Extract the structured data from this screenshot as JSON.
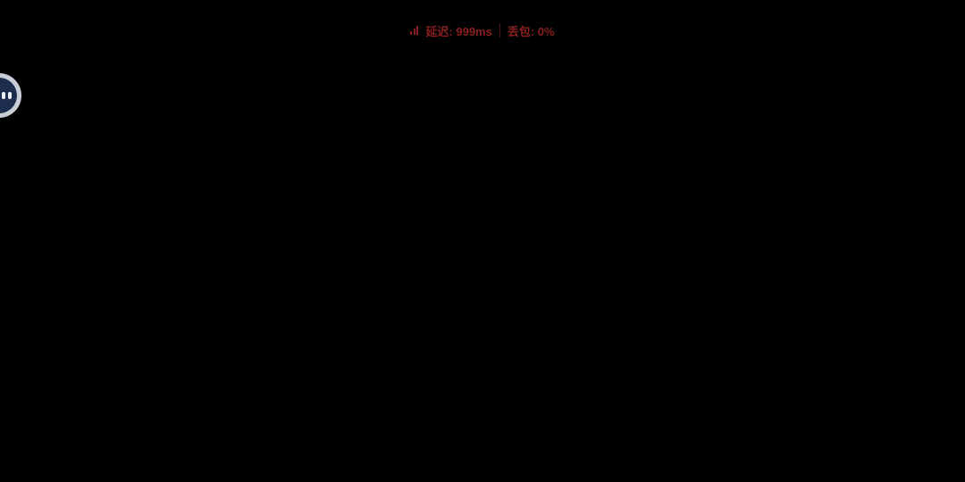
{
  "stream": {
    "background": "#000000"
  },
  "network_status": {
    "icon": "signal-bars-icon",
    "latency_label": "延迟: 999ms",
    "packet_loss_label": "丢包: 0%",
    "color": "#8a1f1f"
  },
  "floating_ball": {
    "icon": "assistant-face-icon"
  }
}
